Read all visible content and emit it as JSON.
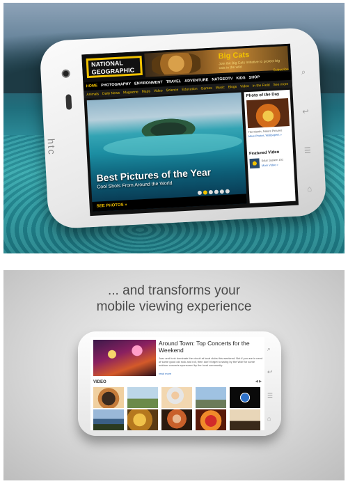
{
  "panel1": {
    "phone_brand": "htc",
    "site": {
      "logo_line1": "NATIONAL",
      "logo_line2": "GEOGRAPHIC",
      "banner_title": "Big Cats",
      "banner_text": "Join the Big Cats Initiative to protect big cats in the wild",
      "subscribe": "Subscribe",
      "nav": [
        "HOME",
        "PHOTOGRAPHY",
        "ENVIRONMENT",
        "TRAVEL",
        "ADVENTURE",
        "NATGEOTV",
        "KIDS",
        "SHOP"
      ],
      "subnav": [
        "Animals",
        "Daily News",
        "Magazine",
        "Maps",
        "Video",
        "Science",
        "Education",
        "Games",
        "Music",
        "Blogs",
        "Video",
        "In the Field",
        "See more"
      ],
      "hero_title": "Best Pictures of the Year",
      "hero_subtitle": "Cool Shots From Around the World",
      "see_photos": "SEE PHOTOS »",
      "photo_of_day_title": "Photo of the Day",
      "photo_of_day_caption": "The Month, Nature Pictures",
      "photo_of_day_more": "More Photos, Wallpapers »",
      "featured_video_title": "Featured Video",
      "featured_video_caption": "Solar System 101",
      "featured_video_more": "More Video »"
    }
  },
  "panel2": {
    "tagline_line1": "... and transforms your",
    "tagline_line2": "mobile viewing experience",
    "article_title": "Around Town: Top Concerts for the Weekend",
    "article_body": "Jazz and funk dominate the circuit at local clubs this weekend. But if you are in need of some good old rock and roll, then don't forget to swing by the Wolf for some outdoor concerts sponsored by the local community.",
    "article_more": "read more",
    "video_label": "VIDEO",
    "video_pager": "◀ ▶"
  },
  "colors": {
    "natgeo_yellow": "#f2c200",
    "link_blue": "#2a6bbf"
  }
}
